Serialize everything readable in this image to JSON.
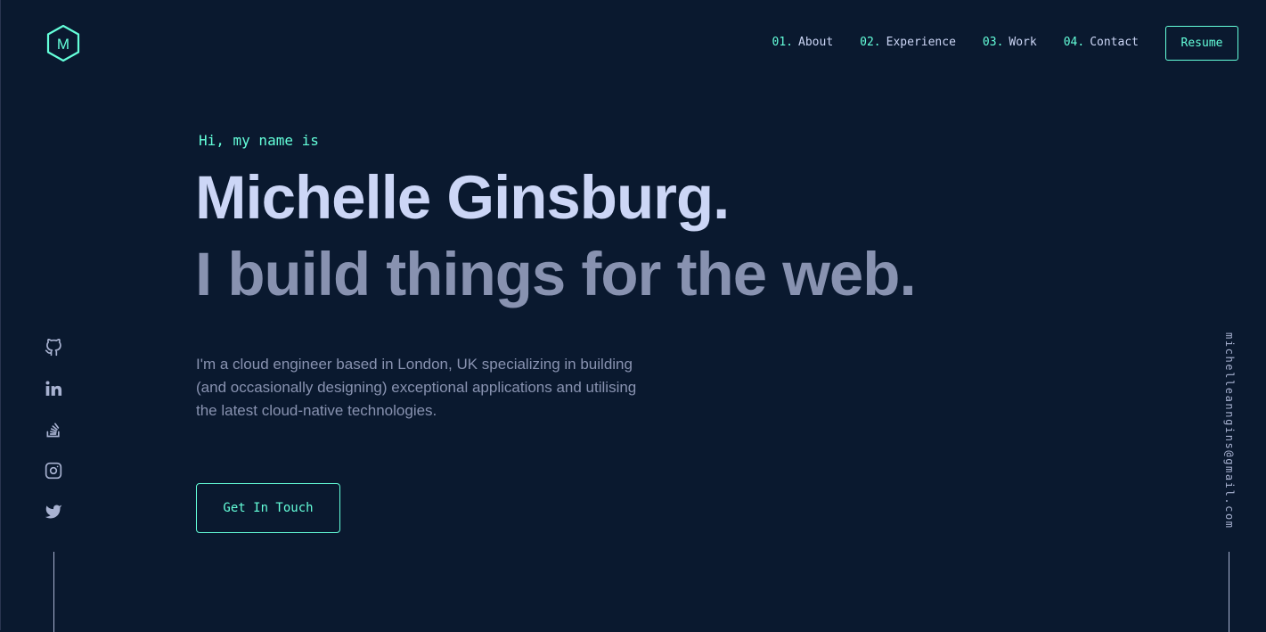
{
  "logo": {
    "letter": "M"
  },
  "nav": {
    "items": [
      {
        "num": "01.",
        "label": "About"
      },
      {
        "num": "02.",
        "label": "Experience"
      },
      {
        "num": "03.",
        "label": "Work"
      },
      {
        "num": "04.",
        "label": "Contact"
      }
    ],
    "resume_label": "Resume"
  },
  "hero": {
    "greeting": "Hi, my name is",
    "name": "Michelle Ginsburg.",
    "tagline": "I build things for the web.",
    "bio": "I'm a cloud engineer based in London, UK specializing in building (and occasionally designing) exceptional applications and utilising the latest cloud-native technologies.",
    "cta_label": "Get In Touch"
  },
  "social": {
    "icons": [
      "github-icon",
      "linkedin-icon",
      "stackoverflow-icon",
      "instagram-icon",
      "twitter-icon"
    ]
  },
  "email": "michelleanngins@gmail.com",
  "colors": {
    "background": "#0a192f",
    "accent": "#64ffda",
    "heading": "#ccd6f6",
    "muted": "#8892b0",
    "light_slate": "#a8b2d1"
  }
}
